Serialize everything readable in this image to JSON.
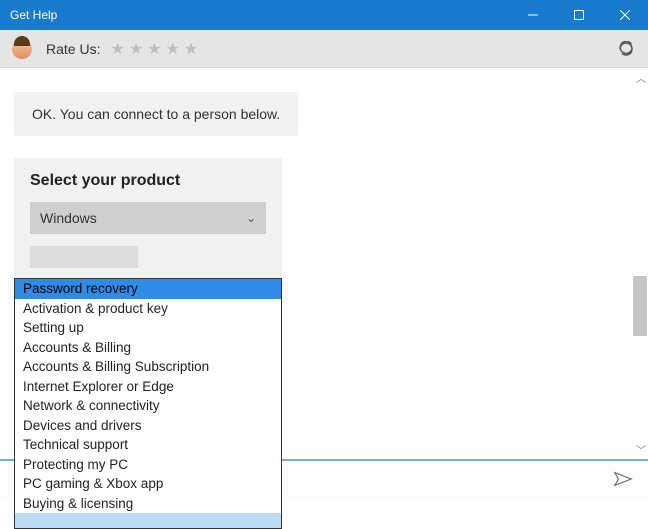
{
  "titlebar": {
    "title": "Get Help"
  },
  "ratebar": {
    "label": "Rate Us:"
  },
  "bubble": {
    "text": "OK. You can connect to a person below."
  },
  "card": {
    "heading": "Select your product",
    "select_value": "Windows"
  },
  "dropdown": {
    "options": [
      "Password recovery",
      "Activation & product key",
      "Setting up",
      "Accounts & Billing",
      "Accounts & Billing Subscription",
      "Internet Explorer or Edge",
      "Network & connectivity",
      "Devices and drivers",
      "Technical support",
      "Protecting my PC",
      "PC gaming & Xbox app",
      "Buying & licensing"
    ],
    "selected_index": 0
  }
}
